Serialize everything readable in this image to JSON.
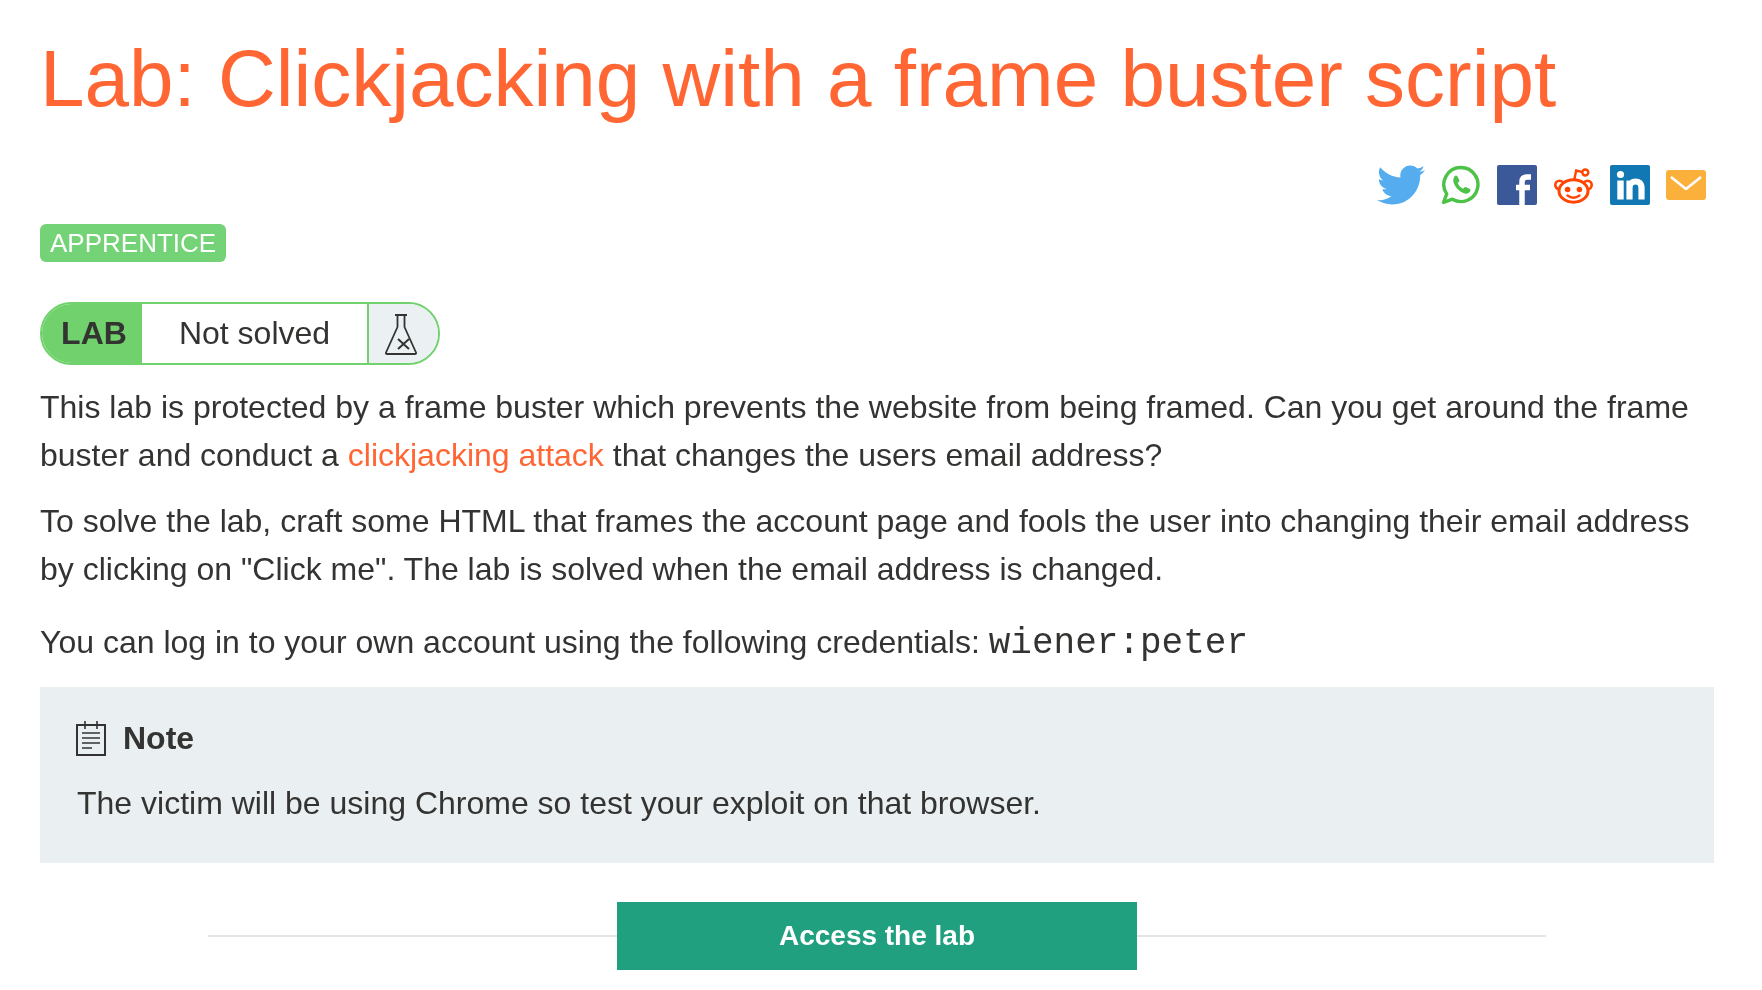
{
  "title": "Lab: Clickjacking with a frame buster script",
  "level_badge": "APPRENTICE",
  "lab_status": {
    "label": "LAB",
    "status": "Not solved",
    "solved": false
  },
  "intro": {
    "text_before": "This lab is protected by a frame buster which prevents the website from being framed. Can you get around the frame buster and conduct a ",
    "link": "clickjacking attack",
    "text_after": " that changes the users email address?"
  },
  "instructions": "To solve the lab, craft some HTML that frames the account page and fools the user into changing their email address by clicking on \"Click me\". The lab is solved when the email address is changed.",
  "credentials": {
    "text": "You can log in to your own account using the following credentials: ",
    "code": "wiener:peter"
  },
  "note": {
    "title": "Note",
    "text": "The victim will be using Chrome so test your exploit on that browser."
  },
  "access_button": "Access the lab"
}
